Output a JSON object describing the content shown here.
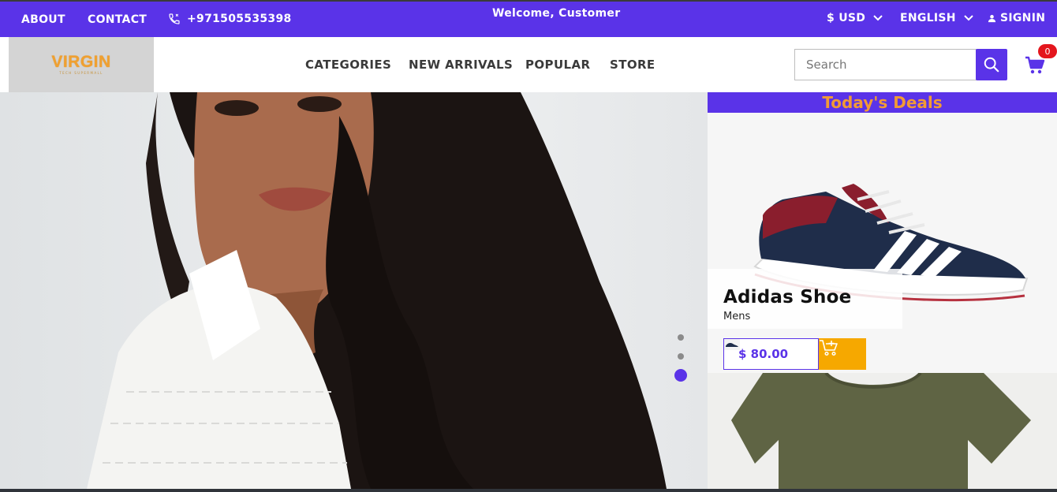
{
  "topbar": {
    "about": "ABOUT",
    "contact": "CONTACT",
    "phone": "+971505535398",
    "welcome": "Welcome, Customer",
    "currency": "$ USD",
    "language": "ENGLISH",
    "signin": "SIGNIN"
  },
  "header": {
    "logo_text": "VIRGIN",
    "logo_subtext": "TECH SUPERMALL",
    "nav": [
      "CATEGORIES",
      "NEW ARRIVALS",
      "POPULAR",
      "STORE"
    ],
    "search_placeholder": "Search",
    "cart_count": "0"
  },
  "hero": {
    "slides_total": 3,
    "active_slide": 3
  },
  "deals": {
    "title": "Today's Deals",
    "items": [
      {
        "name": "Adidas Shoe",
        "category": "Mens",
        "price": "$ 80.00"
      }
    ]
  },
  "colors": {
    "accent": "#5a33e8",
    "deals_title": "#f29a35",
    "add_to_cart": "#f6a800",
    "badge": "#e4161d"
  },
  "icons": [
    "phone-icon",
    "chevron-down-icon",
    "user-icon",
    "search-icon",
    "cart-icon",
    "add-to-cart-icon"
  ]
}
